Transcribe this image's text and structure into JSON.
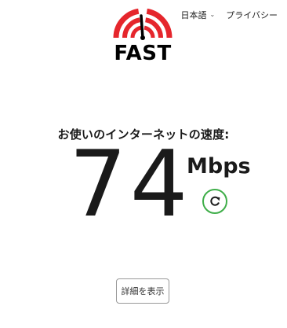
{
  "brand": {
    "logo_text": "FAST",
    "accent_color": "#e5262c"
  },
  "topnav": {
    "language_label": "日本語",
    "privacy_label": "プライバシー"
  },
  "speed": {
    "label": "お使いのインターネットの速度:",
    "value": "74",
    "unit": "Mbps"
  },
  "actions": {
    "refresh_icon": "refresh-icon",
    "refresh_color": "#3fae49",
    "details_label": "詳細を表示"
  }
}
